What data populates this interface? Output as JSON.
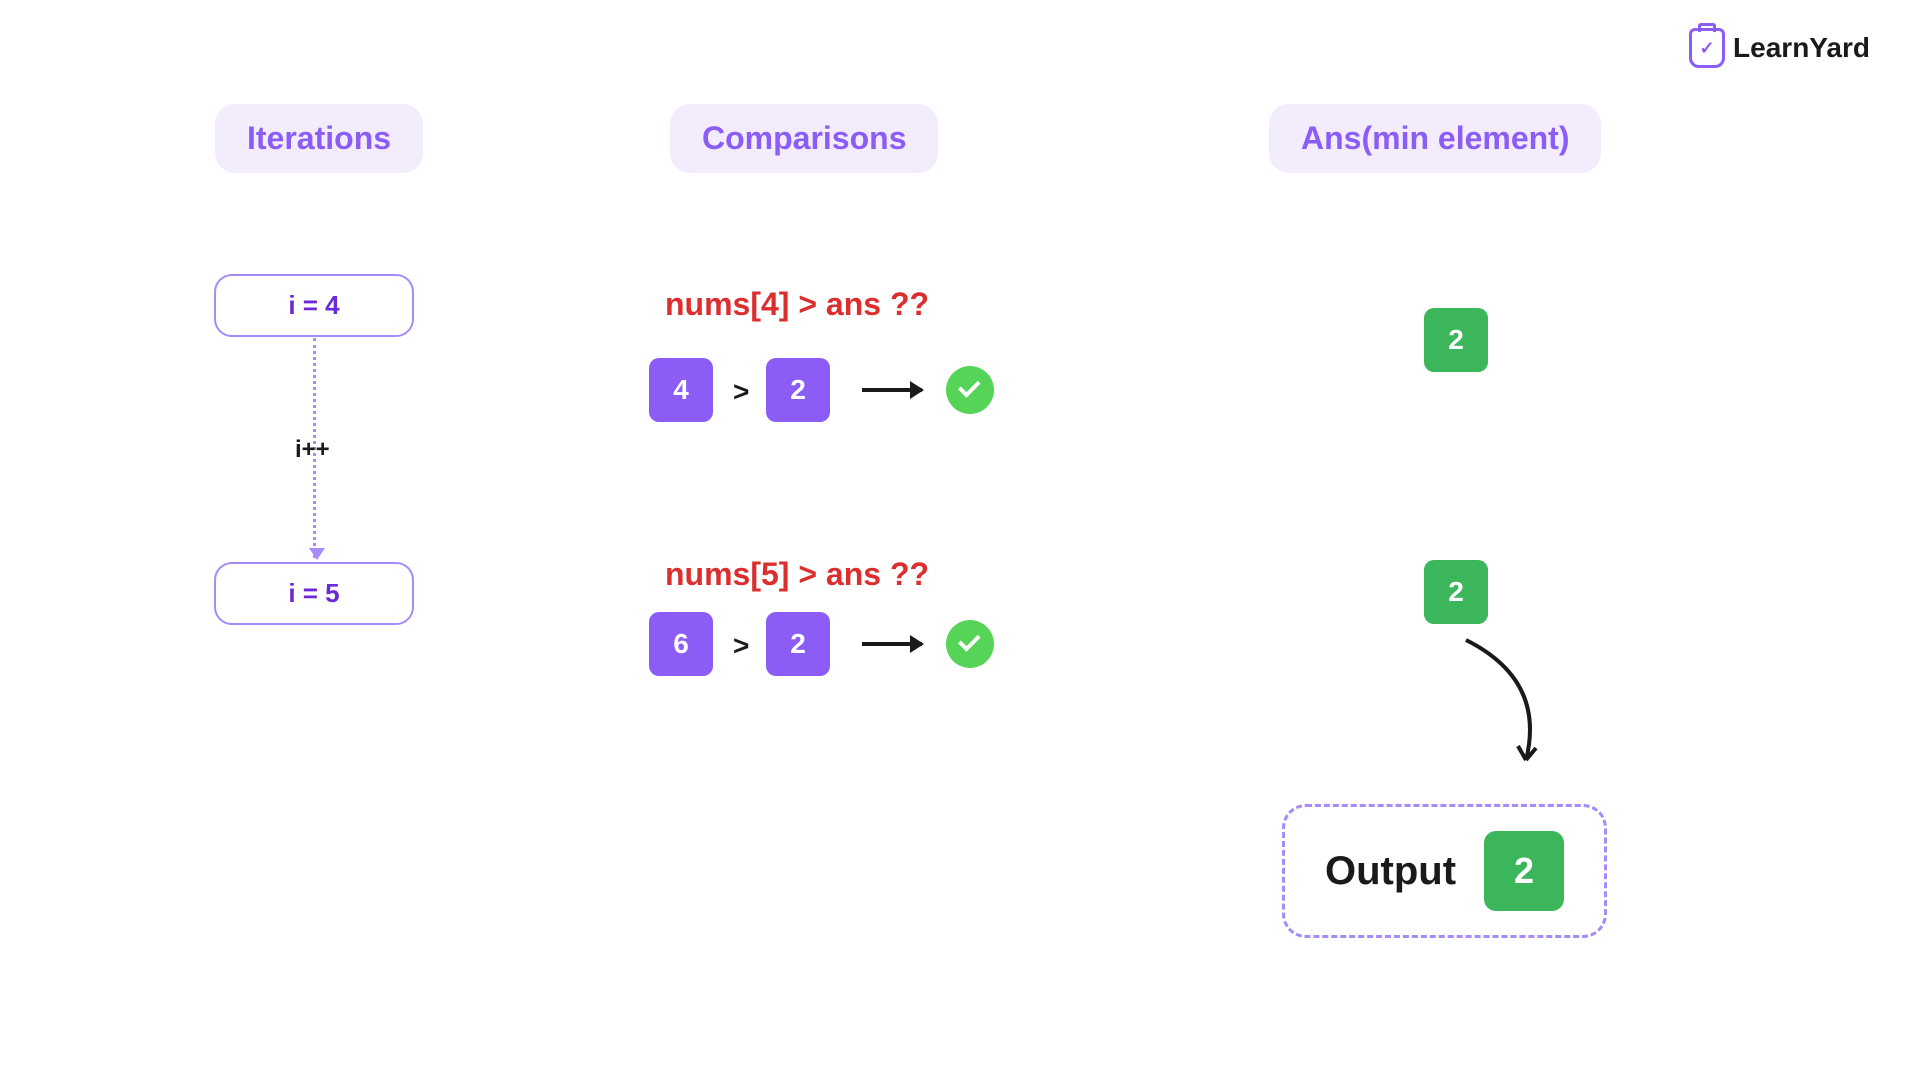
{
  "brand": {
    "name": "LearnYard"
  },
  "headers": {
    "iterations": "Iterations",
    "comparisons": "Comparisons",
    "ans": "Ans(min element)"
  },
  "iterations": {
    "first": "i = 4",
    "increment": "i++",
    "second": "i = 5"
  },
  "comparisons": {
    "row1": {
      "question": "nums[4] > ans ??",
      "left": "4",
      "op": ">",
      "right": "2"
    },
    "row2": {
      "question": "nums[5] > ans ??",
      "left": "6",
      "op": ">",
      "right": "2"
    }
  },
  "ans": {
    "row1": "2",
    "row2": "2"
  },
  "output": {
    "label": "Output",
    "value": "2"
  }
}
